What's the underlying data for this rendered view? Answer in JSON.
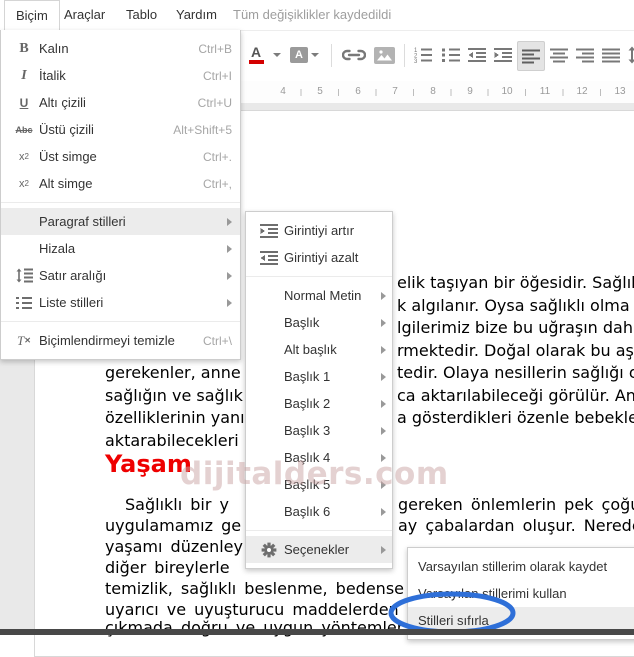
{
  "menubar": {
    "items": [
      {
        "label": "Biçim"
      },
      {
        "label": "Araçlar"
      },
      {
        "label": "Tablo"
      },
      {
        "label": "Yardım"
      }
    ],
    "status": "Tüm değişiklikler kaydedildi"
  },
  "toolbar": {
    "text_color_label": "A",
    "highlight_label": "A",
    "active_icon": "align-left",
    "accent_red": "#d40000"
  },
  "ruler": {
    "numbers": [
      "4",
      "5",
      "6",
      "7",
      "8",
      "9",
      "10",
      "11",
      "12",
      "13"
    ]
  },
  "format_menu": {
    "items": [
      {
        "label": "Kalın",
        "shortcut": "Ctrl+B"
      },
      {
        "label": "İtalik",
        "shortcut": "Ctrl+I"
      },
      {
        "label": "Altı çizili",
        "shortcut": "Ctrl+U"
      },
      {
        "label": "Üstü çizili",
        "shortcut": "Alt+Shift+5"
      },
      {
        "label": "Üst simge",
        "shortcut": "Ctrl+."
      },
      {
        "label": "Alt simge",
        "shortcut": "Ctrl+,"
      },
      {
        "label": "Paragraf stilleri",
        "submenu": true,
        "highlighted": true
      },
      {
        "label": "Hizala",
        "submenu": true
      },
      {
        "label": "Satır aralığı",
        "submenu": true
      },
      {
        "label": "Liste stilleri",
        "submenu": true
      },
      {
        "label": "Biçimlendirmeyi temizle",
        "shortcut": "Ctrl+\\"
      }
    ]
  },
  "styles_submenu": {
    "items": [
      {
        "label": "Girintiyi artır"
      },
      {
        "label": "Girintiyi azalt"
      },
      {
        "label": "Normal Metin",
        "submenu": true
      },
      {
        "label": "Başlık",
        "submenu": true
      },
      {
        "label": "Alt başlık",
        "submenu": true
      },
      {
        "label": "Başlık 1",
        "submenu": true
      },
      {
        "label": "Başlık 2",
        "submenu": true
      },
      {
        "label": "Başlık 3",
        "submenu": true
      },
      {
        "label": "Başlık 4",
        "submenu": true
      },
      {
        "label": "Başlık 5",
        "submenu": true
      },
      {
        "label": "Başlık 6",
        "submenu": true
      },
      {
        "label": "Seçenekler",
        "submenu": true,
        "highlighted": true
      }
    ]
  },
  "options_submenu": {
    "items": [
      {
        "label": "Varsayılan stillerim olarak kaydet"
      },
      {
        "label": "Varsayılan stillerimi kullan"
      },
      {
        "label": "Stilleri sıfırla",
        "highlighted": true,
        "circled": true
      }
    ],
    "annotation_color": "#2e6fd8"
  },
  "document": {
    "heading": "Yaşam",
    "heading_color": "#ee0000",
    "watermark": "dijitalders.com",
    "fragments": [
      {
        "text": "elik taşıyan bir öğesidir. Sağlık gene"
      },
      {
        "text": "k algılanır. Oysa sağlıklı olma uğrund"
      },
      {
        "text": "lgilerimiz bize bu uğraşın daha doğu"
      },
      {
        "text": "rmektedir. Doğal olarak bu aşamad"
      },
      {
        "text": "tedir. Olaya nesillerin sağlığı olarak"
      },
      {
        "text": "ca aktarılabileceği görülür. Anne ve b"
      },
      {
        "text": "a gösterdikleri özenle bebeklerine s"
      },
      {
        "text": "gerekenler, anne"
      },
      {
        "text": "sağlığın ve sağlık"
      },
      {
        "text": "özelliklerinin yanı"
      },
      {
        "text": "aktarabilecekleri"
      },
      {
        "text": "Sağlıklı bir y"
      },
      {
        "text": "uygulamamız ge"
      },
      {
        "text": "yaşamı düzenley"
      },
      {
        "text": "diğer bireylerle"
      },
      {
        "text": "temizlik, sağlıklı beslenme, bedense"
      },
      {
        "text": "uyarıcı ve uyuşturucu maddelerden"
      },
      {
        "text": "çıkmada doğru ve uygun yöntemler k"
      },
      {
        "text": "gereken önlemlerin pek çoğu gün"
      },
      {
        "text": "ay çabalardan oluşur. Nerede olu"
      }
    ]
  }
}
